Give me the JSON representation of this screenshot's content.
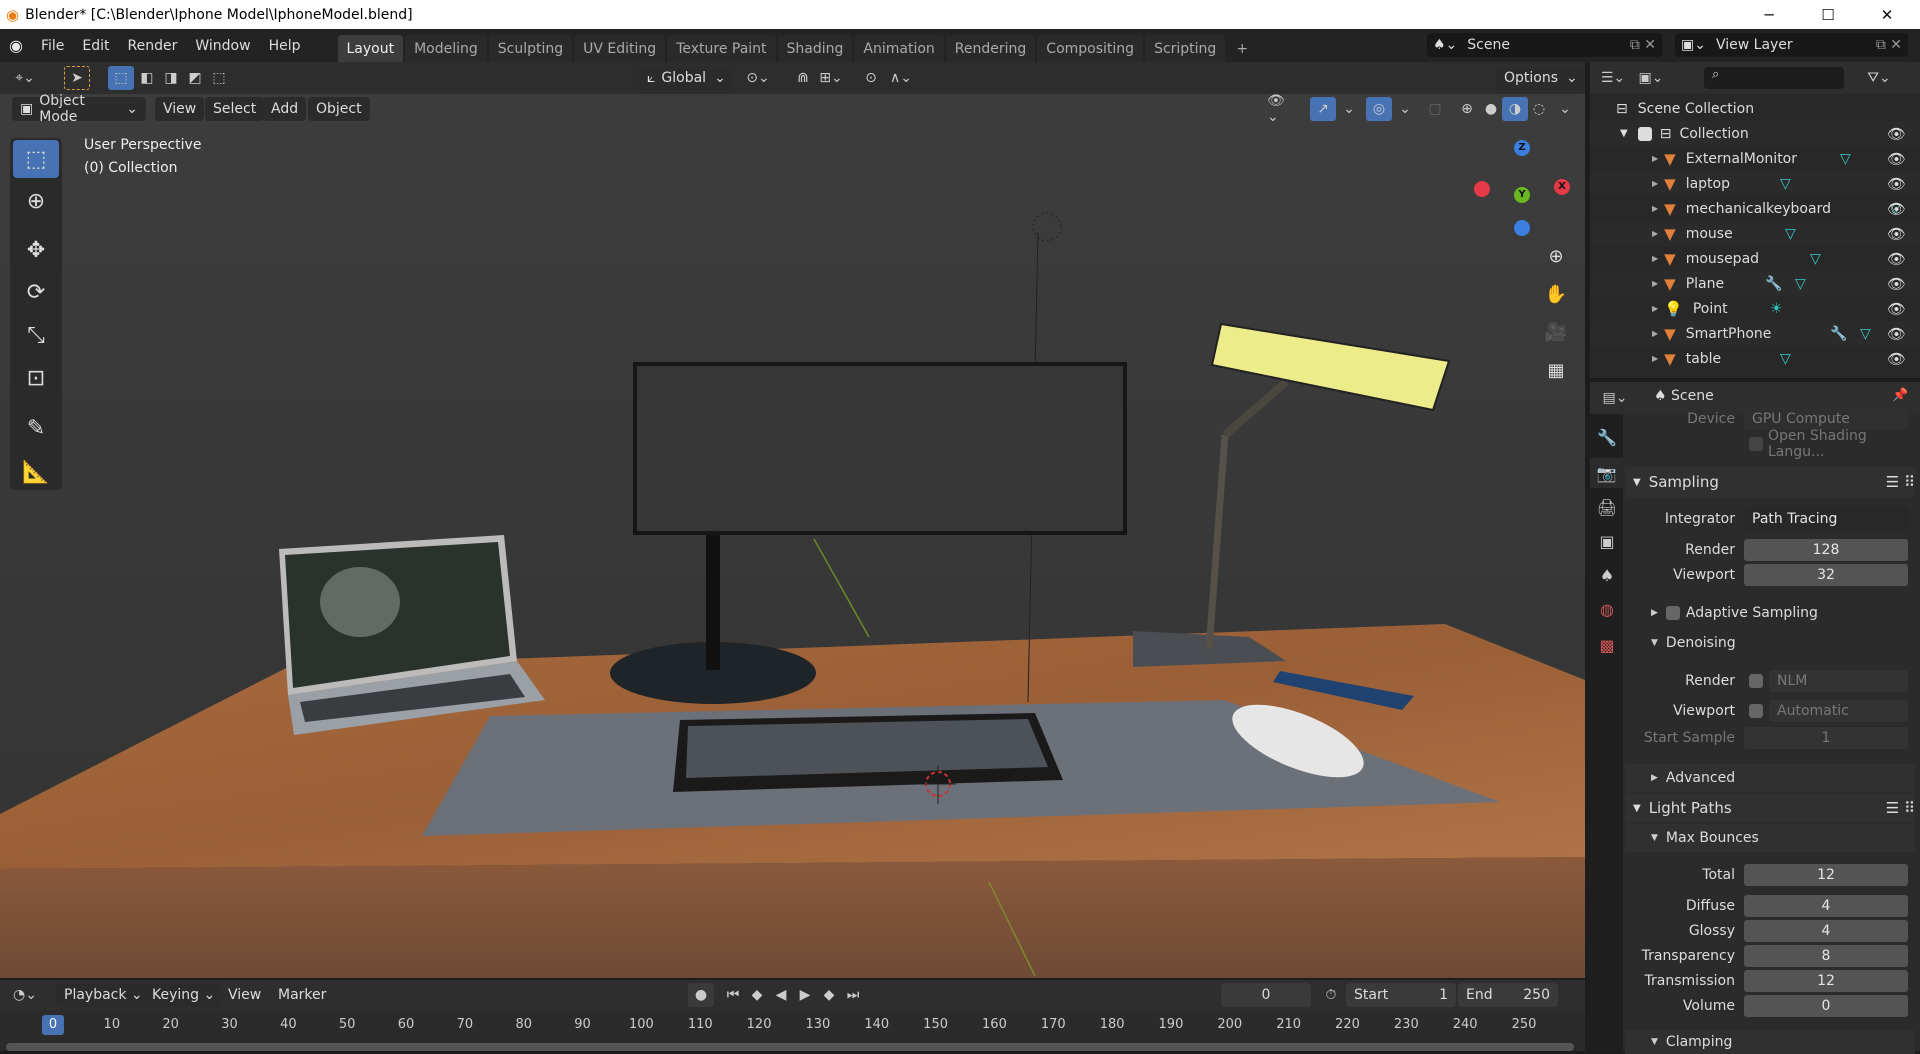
{
  "window": {
    "title": "Blender* [C:\\Blender\\Iphone Model\\IphoneModel.blend]",
    "controls": [
      "─",
      "☐",
      "✕"
    ]
  },
  "menu": [
    "File",
    "Edit",
    "Render",
    "Window",
    "Help"
  ],
  "workspaces": [
    "Layout",
    "Modeling",
    "Sculpting",
    "UV Editing",
    "Texture Paint",
    "Shading",
    "Animation",
    "Rendering",
    "Compositing",
    "Scripting",
    "+"
  ],
  "scene_selector": {
    "value": "Scene"
  },
  "view_layer_selector": {
    "value": "View Layer"
  },
  "toolbar": {
    "orientation": "Global",
    "options": "Options"
  },
  "viewport_header": {
    "mode": "Object Mode",
    "menus": [
      "View",
      "Select",
      "Add",
      "Object"
    ]
  },
  "viewport": {
    "perspective": "User Perspective",
    "collection": "(0) Collection",
    "gizmo": {
      "x": "X",
      "y": "Y",
      "z": "Z"
    }
  },
  "colors": {
    "accent": "#4772b3",
    "object": "#e0803a",
    "mesh_data": "#33cccc",
    "x_axis": "#e63946",
    "y_axis": "#6ab820",
    "z_axis": "#3b7fe0"
  },
  "outliner": {
    "root": "Scene Collection",
    "collection": "Collection",
    "items": [
      {
        "name": "ExternalMonitor",
        "icon": "mesh-object",
        "extras": [
          "mesh"
        ]
      },
      {
        "name": "laptop",
        "icon": "mesh-object",
        "extras": [
          "mesh"
        ]
      },
      {
        "name": "mechanicalkeyboard",
        "icon": "mesh-object",
        "extras": [
          "mesh"
        ]
      },
      {
        "name": "mouse",
        "icon": "mesh-object",
        "extras": [
          "mesh"
        ]
      },
      {
        "name": "mousepad",
        "icon": "mesh-object",
        "extras": [
          "mesh"
        ]
      },
      {
        "name": "Plane",
        "icon": "mesh-object",
        "extras": [
          "modifier",
          "mesh"
        ]
      },
      {
        "name": "Point",
        "icon": "light-object",
        "extras": [
          "light"
        ]
      },
      {
        "name": "SmartPhone",
        "icon": "mesh-object",
        "extras": [
          "modifier",
          "mesh"
        ]
      },
      {
        "name": "table",
        "icon": "mesh-object",
        "extras": [
          "mesh"
        ]
      }
    ]
  },
  "properties": {
    "context": "Scene",
    "device": {
      "label": "Device",
      "value": "GPU Compute"
    },
    "osl": "Open Shading Langu...",
    "sampling": {
      "title": "Sampling",
      "integrator_label": "Integrator",
      "integrator": "Path Tracing",
      "render_label": "Render",
      "render": "128",
      "viewport_label": "Viewport",
      "viewport": "32",
      "adaptive": "Adaptive Sampling",
      "denoising": {
        "title": "Denoising",
        "render_label": "Render",
        "render": "NLM",
        "viewport_label": "Viewport",
        "viewport": "Automatic",
        "start_label": "Start Sample",
        "start": "1"
      },
      "advanced": "Advanced"
    },
    "light_paths": {
      "title": "Light Paths",
      "max_bounces": "Max Bounces",
      "rows": [
        {
          "label": "Total",
          "value": "12"
        },
        {
          "label": "Diffuse",
          "value": "4"
        },
        {
          "label": "Glossy",
          "value": "4"
        },
        {
          "label": "Transparency",
          "value": "8"
        },
        {
          "label": "Transmission",
          "value": "12"
        },
        {
          "label": "Volume",
          "value": "0"
        }
      ],
      "clamping": "Clamping"
    }
  },
  "timeline": {
    "menus": [
      "Playback",
      "Keying",
      "View",
      "Marker"
    ],
    "current_frame": "0",
    "start_label": "Start",
    "start": "1",
    "end_label": "End",
    "end": "250",
    "frames": [
      "0",
      "10",
      "20",
      "30",
      "40",
      "50",
      "60",
      "70",
      "80",
      "90",
      "100",
      "110",
      "120",
      "130",
      "140",
      "150",
      "160",
      "170",
      "180",
      "190",
      "200",
      "210",
      "220",
      "230",
      "240",
      "250"
    ]
  }
}
